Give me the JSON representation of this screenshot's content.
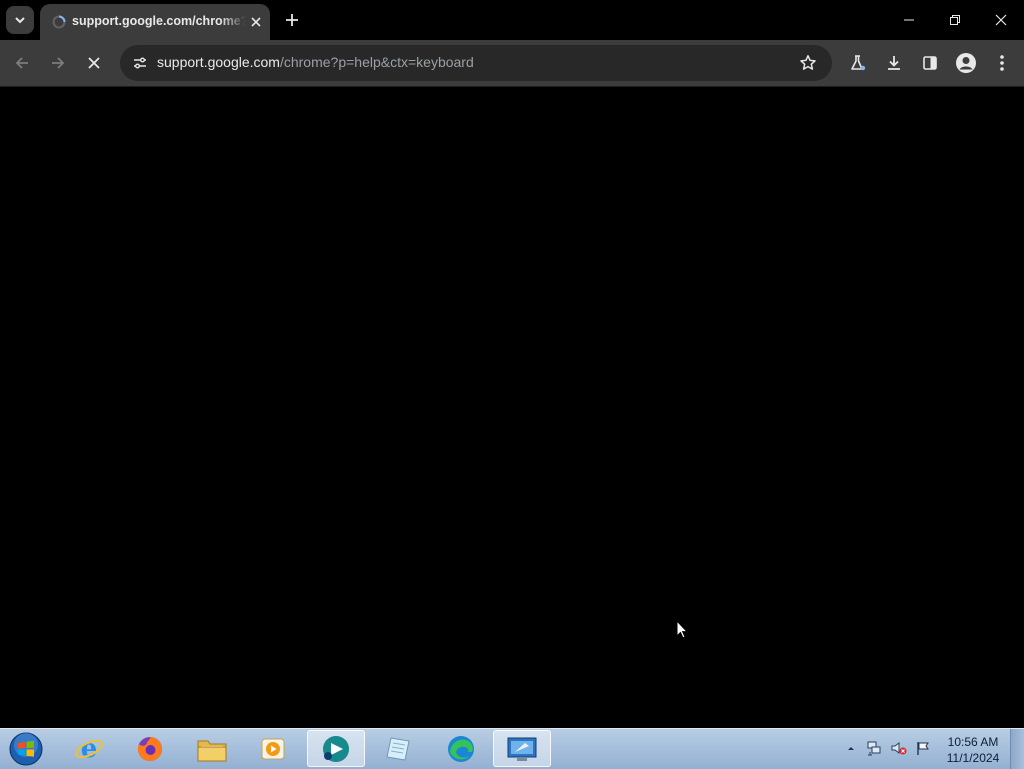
{
  "browser": {
    "tab": {
      "title": "support.google.com/chrome?p=help&ctx=keyboard"
    },
    "address_bar": {
      "host": "support.google.com",
      "path": "/chrome?p=help&ctx=keyboard"
    },
    "toolbar_icons": [
      "back-icon",
      "forward-icon",
      "stop-loading-icon",
      "site-info-icon",
      "bookmark-star-icon",
      "labs-flask-icon",
      "download-icon",
      "side-panel-icon",
      "profile-avatar-icon",
      "menu-icon"
    ],
    "colors": {
      "tabstrip": "#000000",
      "toolbar": "#3c3c3c",
      "omnibox": "#282828",
      "content": "#000000"
    }
  },
  "taskbar": {
    "apps": [
      "internet-explorer",
      "firefox",
      "file-explorer",
      "media-player",
      "active-app",
      "notepad",
      "edge",
      "remote-desktop"
    ],
    "clock": {
      "time": "10:56 AM",
      "date": "11/1/2024"
    }
  }
}
